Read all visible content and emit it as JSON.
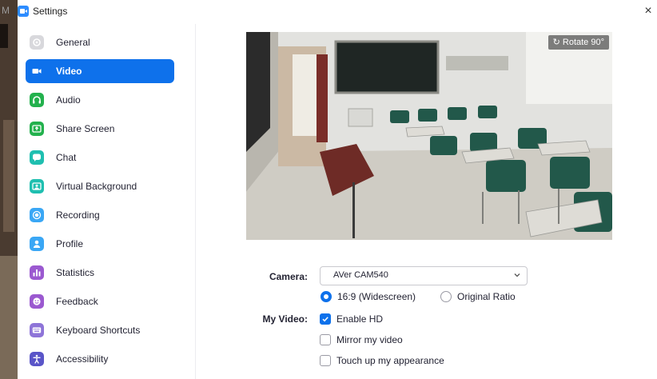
{
  "background": {
    "letter": "M"
  },
  "window": {
    "title": "Settings",
    "close_glyph": "×"
  },
  "sidebar": {
    "items": [
      {
        "label": "General",
        "icon": "gear-icon",
        "color": "#d8d8dc"
      },
      {
        "label": "Video",
        "icon": "video-camera-icon",
        "color": "#0e71eb",
        "active": true
      },
      {
        "label": "Audio",
        "icon": "headphones-icon",
        "color": "#23b14d"
      },
      {
        "label": "Share Screen",
        "icon": "share-screen-icon",
        "color": "#23b14d"
      },
      {
        "label": "Chat",
        "icon": "chat-icon",
        "color": "#1fbfb0"
      },
      {
        "label": "Virtual Background",
        "icon": "virtual-background-icon",
        "color": "#1fbfb0"
      },
      {
        "label": "Recording",
        "icon": "recording-icon",
        "color": "#3aa7f5"
      },
      {
        "label": "Profile",
        "icon": "profile-icon",
        "color": "#3aa7f5"
      },
      {
        "label": "Statistics",
        "icon": "statistics-icon",
        "color": "#9b59d0"
      },
      {
        "label": "Feedback",
        "icon": "feedback-icon",
        "color": "#9b59d0"
      },
      {
        "label": "Keyboard Shortcuts",
        "icon": "keyboard-icon",
        "color": "#8e74d8"
      },
      {
        "label": "Accessibility",
        "icon": "accessibility-icon",
        "color": "#5a55c8"
      }
    ]
  },
  "video": {
    "rotate_label": "Rotate 90°",
    "camera_label": "Camera:",
    "camera_value": "AVer CAM540",
    "aspect_options": [
      {
        "label": "16:9 (Widescreen)",
        "selected": true
      },
      {
        "label": "Original Ratio",
        "selected": false
      }
    ],
    "my_video_label": "My Video:",
    "checkboxes": [
      {
        "label": "Enable HD",
        "checked": true
      },
      {
        "label": "Mirror my video",
        "checked": false
      },
      {
        "label": "Touch up my appearance",
        "checked": false
      }
    ]
  }
}
